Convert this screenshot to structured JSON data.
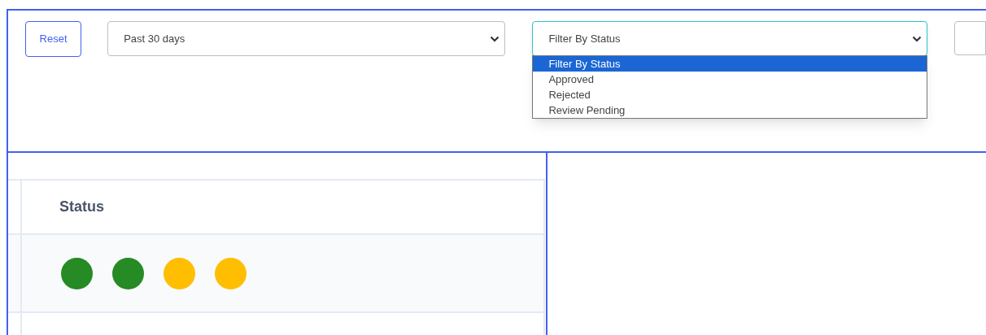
{
  "reset_button": {
    "label": "Reset"
  },
  "date_select": {
    "value": "Past 30 days"
  },
  "status_select": {
    "value": "Filter By Status",
    "expanded": true,
    "options": [
      {
        "label": "Filter By Status",
        "selected": true
      },
      {
        "label": "Approved",
        "selected": false
      },
      {
        "label": "Rejected",
        "selected": false
      },
      {
        "label": "Review Pending",
        "selected": false
      }
    ]
  },
  "table": {
    "columns": [
      "Status"
    ],
    "rows": [
      {
        "status_dots": [
          {
            "color": "#268a25"
          },
          {
            "color": "#268a25"
          },
          {
            "color": "#ffbe00"
          },
          {
            "color": "#ffbe00"
          }
        ]
      }
    ]
  }
}
